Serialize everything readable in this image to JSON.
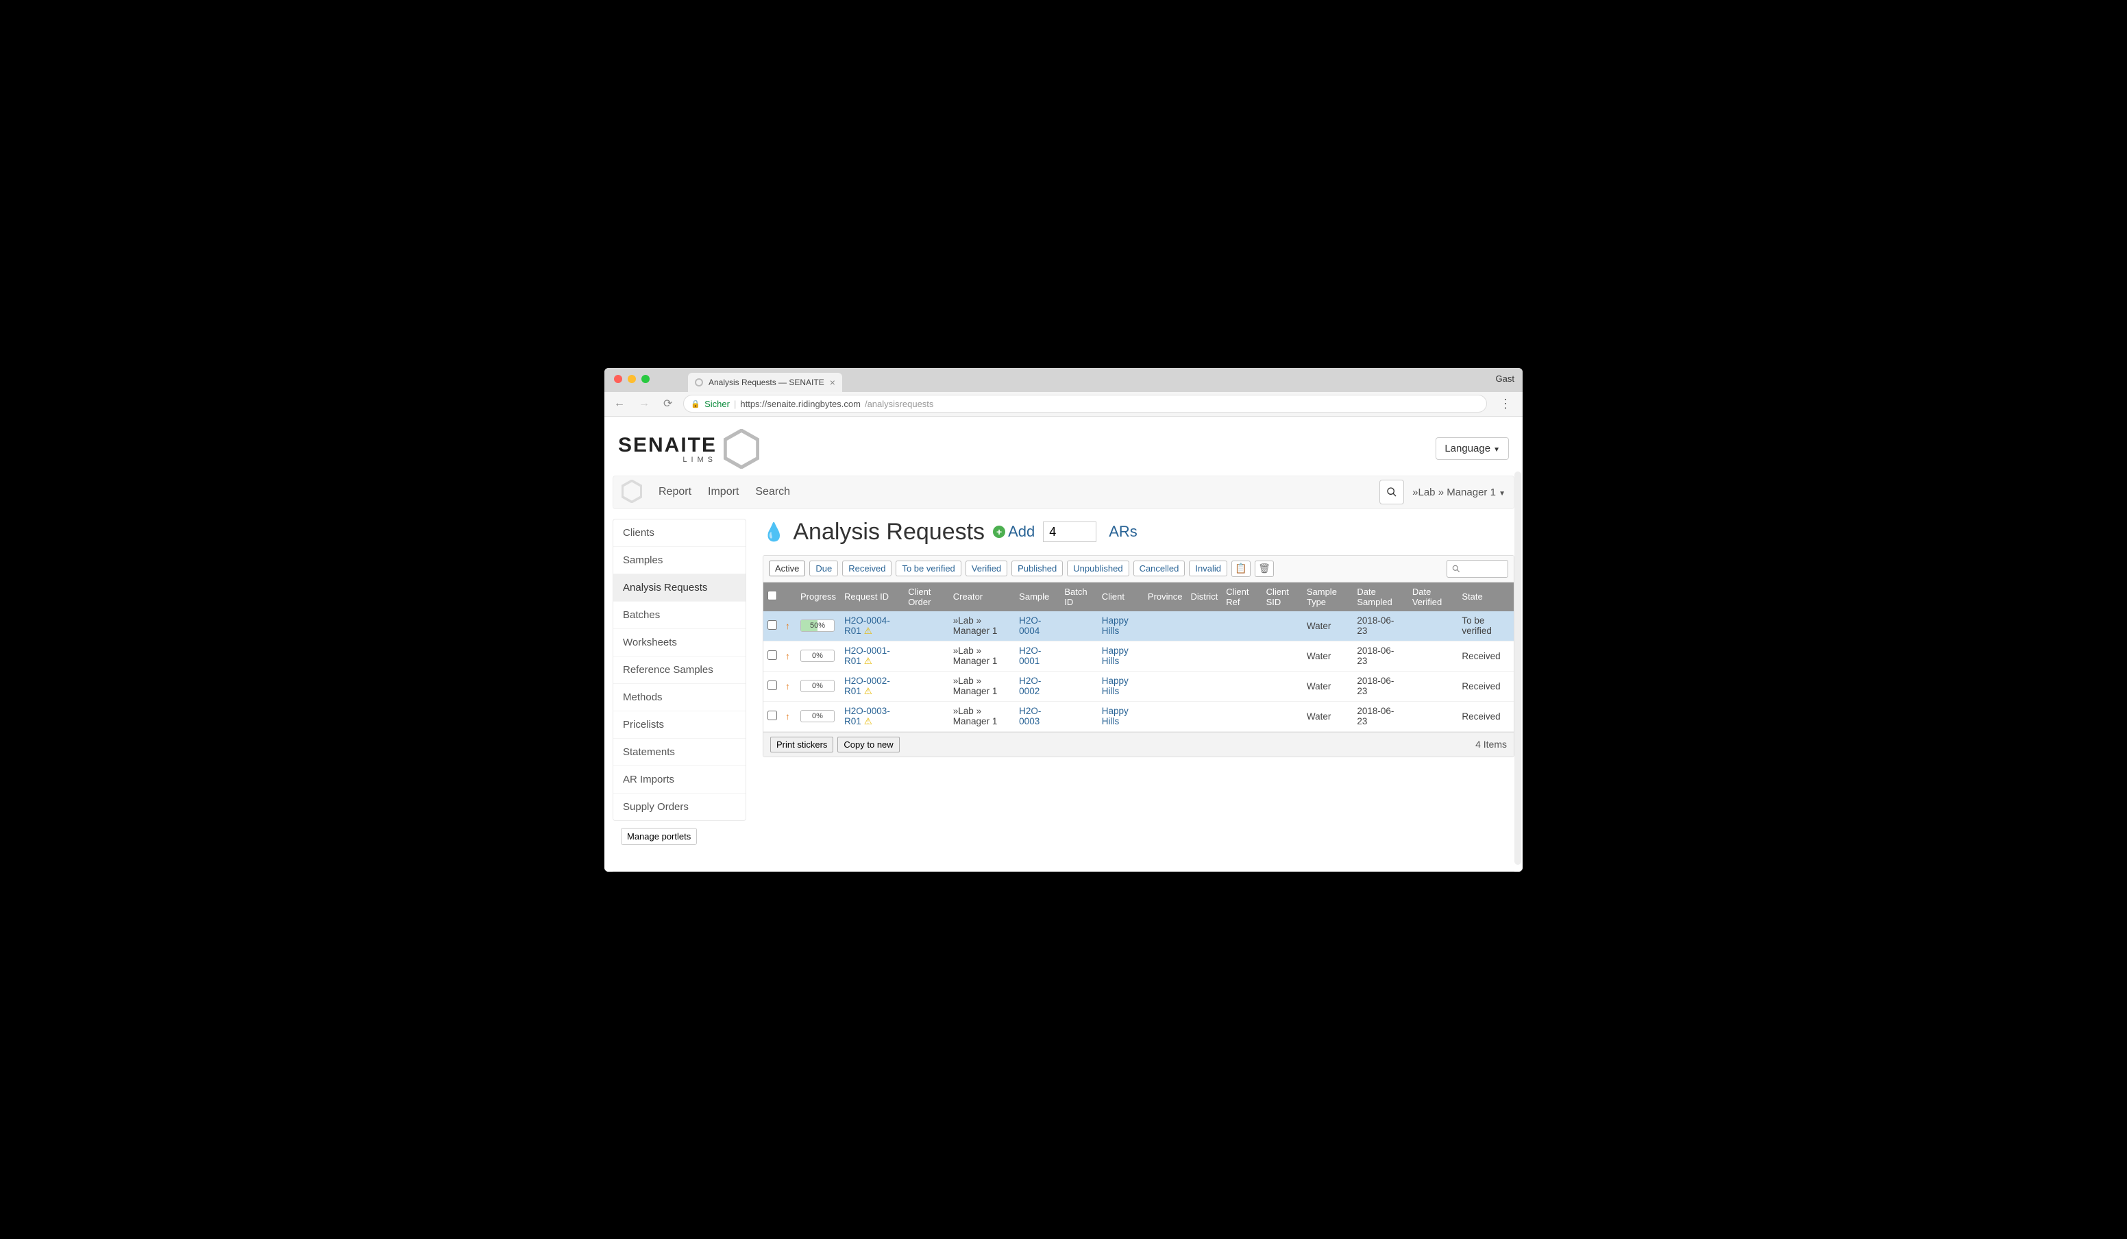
{
  "browser": {
    "tab_title": "Analysis Requests — SENAITE",
    "profile": "Gast",
    "secure_label": "Sicher",
    "url_prefix": "https://",
    "url_host": "senaite.ridingbytes.com",
    "url_path": "/analysisrequests"
  },
  "header": {
    "logo_text": "SENAITE",
    "logo_sub": "LIMS",
    "language_label": "Language"
  },
  "navbar": {
    "links": [
      "Report",
      "Import",
      "Search"
    ],
    "user_label": "»Lab » Manager 1"
  },
  "sidebar": {
    "items": [
      "Clients",
      "Samples",
      "Analysis Requests",
      "Batches",
      "Worksheets",
      "Reference Samples",
      "Methods",
      "Pricelists",
      "Statements",
      "AR Imports",
      "Supply Orders"
    ],
    "active_index": 2,
    "manage_label": "Manage portlets"
  },
  "page": {
    "title": "Analysis Requests",
    "add_label": "Add",
    "count_value": "4",
    "ars_label": "ARs"
  },
  "filters": {
    "tabs": [
      "Active",
      "Due",
      "Received",
      "To be verified",
      "Verified",
      "Published",
      "Unpublished",
      "Cancelled",
      "Invalid"
    ],
    "active_index": 0
  },
  "table": {
    "columns": [
      "",
      "",
      "Progress",
      "Request ID",
      "Client Order",
      "Creator",
      "Sample",
      "Batch ID",
      "Client",
      "Province",
      "District",
      "Client Ref",
      "Client SID",
      "Sample Type",
      "Date Sampled",
      "Date Verified",
      "State"
    ],
    "rows": [
      {
        "highlight": true,
        "progress": "50%",
        "request_id": "H2O-0004-R01",
        "creator": "»Lab » Manager 1",
        "sample": "H2O-0004",
        "client": "Happy Hills",
        "sample_type": "Water",
        "date_sampled": "2018-06-23",
        "state": "To be verified"
      },
      {
        "highlight": false,
        "progress": "0%",
        "request_id": "H2O-0001-R01",
        "creator": "»Lab » Manager 1",
        "sample": "H2O-0001",
        "client": "Happy Hills",
        "sample_type": "Water",
        "date_sampled": "2018-06-23",
        "state": "Received"
      },
      {
        "highlight": false,
        "progress": "0%",
        "request_id": "H2O-0002-R01",
        "creator": "»Lab » Manager 1",
        "sample": "H2O-0002",
        "client": "Happy Hills",
        "sample_type": "Water",
        "date_sampled": "2018-06-23",
        "state": "Received"
      },
      {
        "highlight": false,
        "progress": "0%",
        "request_id": "H2O-0003-R01",
        "creator": "»Lab » Manager 1",
        "sample": "H2O-0003",
        "client": "Happy Hills",
        "sample_type": "Water",
        "date_sampled": "2018-06-23",
        "state": "Received"
      }
    ],
    "footer_buttons": [
      "Print stickers",
      "Copy to new"
    ],
    "items_count": "4 Items"
  }
}
